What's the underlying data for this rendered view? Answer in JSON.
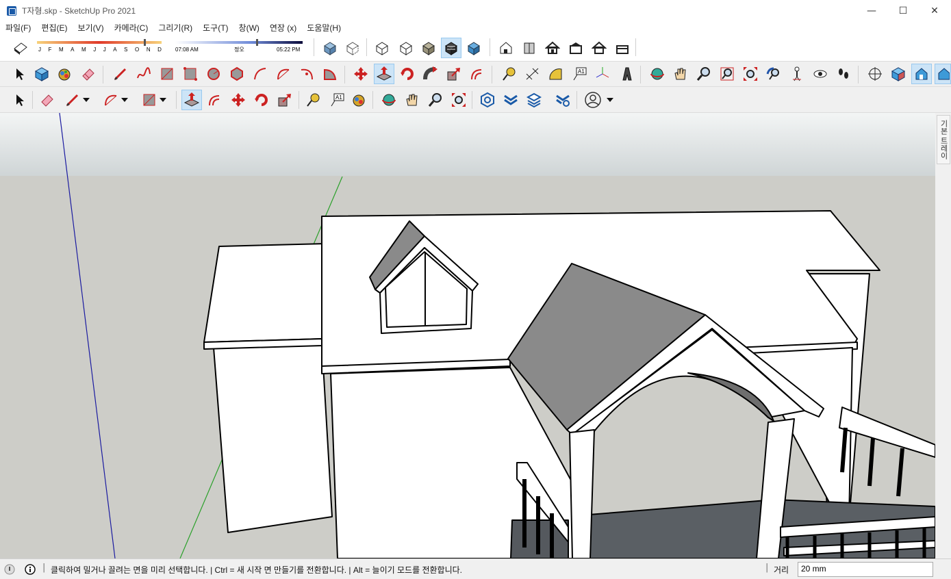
{
  "window": {
    "title": "T자형.skp - SketchUp Pro 2021",
    "minimize": "—",
    "maximize": "☐",
    "close": "✕"
  },
  "menu": [
    "파일(F)",
    "편집(E)",
    "보기(V)",
    "카메라(C)",
    "그리기(R)",
    "도구(T)",
    "창(W)",
    "연장 (x)",
    "도움말(H)"
  ],
  "shadows": {
    "months": [
      "J",
      "F",
      "M",
      "A",
      "M",
      "J",
      "J",
      "A",
      "S",
      "O",
      "N",
      "D"
    ],
    "time_start": "07:08 AM",
    "time_mid": "정오",
    "time_end": "05:22 PM"
  },
  "tray": {
    "label": "기본 트레이"
  },
  "status": {
    "message": "클릭하여 밀거나 끌려는 면을 미리 선택합니다. | Ctrl = 새 시작 면 만들기를 전환합니다. | Alt = 늘이기 모드를 전환합니다.",
    "measure_label": "거리",
    "measure_value": "20 mm"
  },
  "colors": {
    "active_bg": "#cce4f7",
    "sky_top": "#f2f4f4",
    "sky_bottom": "#cfd5d6",
    "ground": "#cdcdc8",
    "axis_blue": "#1a1aa0",
    "axis_green": "#2aa02a"
  }
}
